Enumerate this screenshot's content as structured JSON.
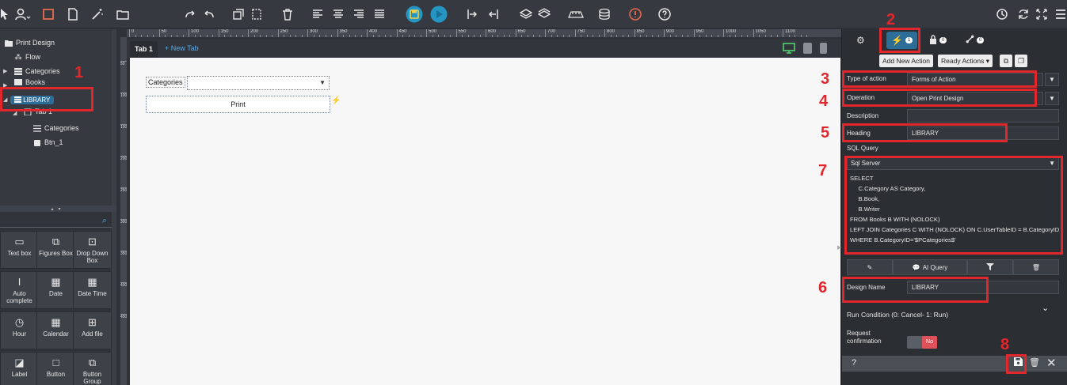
{
  "toolbar": {
    "icons": [
      "pointer-icon",
      "add-user-icon",
      "square-icon",
      "file-icon",
      "magic-wand-icon",
      "folder-icon",
      "redo-icon",
      "undo-icon",
      "copy-icon",
      "paste-icon",
      "trash-icon",
      "align-left-icon",
      "align-center-icon",
      "align-right-icon",
      "justify-icon",
      "save-icon",
      "play-icon",
      "align-start-icon",
      "align-end-icon",
      "layers-up-icon",
      "layers-down-icon",
      "ruler-icon",
      "database-icon",
      "info-icon",
      "help-icon",
      "history-icon",
      "refresh-icon",
      "fullscreen-icon",
      "menu-icon"
    ]
  },
  "tree": {
    "root": "Print Design",
    "flow": "Flow",
    "categories": "Categories",
    "books": "Books",
    "library": "LIBRARY",
    "tab": "Tab 1",
    "child_categories": "Categories",
    "child_btn": "Btn_1"
  },
  "widgets": [
    {
      "label": "Text box",
      "icon": "text-box-icon",
      "glyph": "▭"
    },
    {
      "label": "Figures Box",
      "icon": "figures-box-icon",
      "glyph": "⧉"
    },
    {
      "label": "Drop Down Box",
      "icon": "dropdown-icon",
      "glyph": "⊡"
    },
    {
      "label": "Auto complete",
      "icon": "text-cursor-icon",
      "glyph": "I"
    },
    {
      "label": "Date",
      "icon": "date-icon",
      "glyph": "▦"
    },
    {
      "label": "Date Time",
      "icon": "date-time-icon",
      "glyph": "▦"
    },
    {
      "label": "Hour",
      "icon": "clock-icon",
      "glyph": "◷"
    },
    {
      "label": "Calendar",
      "icon": "calendar-icon",
      "glyph": "▦"
    },
    {
      "label": "Add file",
      "icon": "add-file-icon",
      "glyph": "⊞"
    },
    {
      "label": "Label",
      "icon": "label-icon",
      "glyph": "◪"
    },
    {
      "label": "Button",
      "icon": "button-icon",
      "glyph": "□"
    },
    {
      "label": "Button Group",
      "icon": "button-group-icon",
      "glyph": "⧉"
    }
  ],
  "ruler": {
    "ticks": [
      "0",
      "50",
      "100",
      "150",
      "200",
      "250",
      "300",
      "350",
      "400",
      "450",
      "500",
      "550",
      "600",
      "650",
      "700",
      "750",
      "800",
      "850",
      "900",
      "950",
      "1000",
      "1050",
      "1100"
    ],
    "vticks": [
      "50",
      "100",
      "150",
      "200",
      "250",
      "300",
      "350",
      "400",
      "450"
    ]
  },
  "canvas": {
    "tab_label": "Tab 1",
    "new_tab_label": "+ New Tab",
    "categories_label": "Categories",
    "print_button": "Print"
  },
  "panel": {
    "tabs": [
      {
        "name": "settings",
        "icon": "gear-icon",
        "badge": ""
      },
      {
        "name": "actions",
        "icon": "bolt-icon",
        "badge": "1"
      },
      {
        "name": "permissions",
        "icon": "lock-icon",
        "badge": "0"
      },
      {
        "name": "links",
        "icon": "link-icon",
        "badge": "0"
      }
    ],
    "add_action": "Add New Action",
    "ready_actions": "Ready Actions ▾",
    "type_of_action_label": "Type of action",
    "type_of_action_value": "Forms of Action",
    "operation_label": "Operation",
    "operation_value": "Open Print Design",
    "description_label": "Description",
    "description_value": "",
    "heading_label": "Heading",
    "heading_value": "LIBRARY",
    "sql_label": "SQL Query",
    "sql_engine": "Sql Server",
    "sql_text": "SELECT\n     C.Category AS Category,\n     B.Book,\n     B.Writer\nFROM Books B WITH (NOLOCK)\nLEFT JOIN Categories C WITH (NOLOCK) ON C.UserTableID = B.CategoryID\nWHERE B.CategoryID='$PCategories$'",
    "ai_query": "AI Query",
    "design_name_label": "Design Name",
    "design_name_value": "LIBRARY",
    "run_condition": "Run Condition (0: Cancel- 1: Run)",
    "request_confirmation": "Request confirmation",
    "toggle_value": "No",
    "footer_help": "?"
  },
  "annotations": [
    "1",
    "2",
    "3",
    "4",
    "5",
    "6",
    "7",
    "8"
  ],
  "colors": {
    "annotation": "#e1262c",
    "accent": "#2d6e99",
    "link": "#5aa9e6",
    "toggle_no": "#e0525a"
  }
}
